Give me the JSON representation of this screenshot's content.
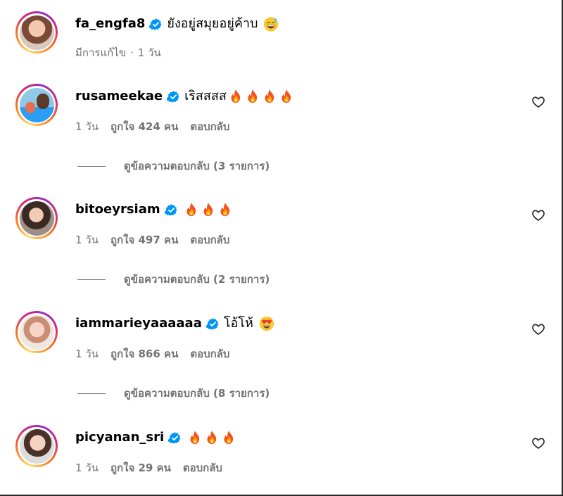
{
  "colors": {
    "verified": "#0095f6",
    "muted_text": "#737373",
    "ring_gradient": [
      "#feda75",
      "#fa7e1e",
      "#d62976",
      "#962fbf"
    ]
  },
  "comments": [
    {
      "username": "fa_engfa8",
      "verified": true,
      "text": "ยังอยู่สมุยอยู่ค้าบ",
      "emoji": "grinning-sweat-emoji",
      "meta": {
        "edited": "มีการแก้ไข",
        "separator": "·",
        "time": "1 วัน"
      }
    },
    {
      "username": "rusameekae",
      "verified": true,
      "text": "เริสสสส",
      "emoji": "fire-emoji",
      "emoji_count": 4,
      "meta": {
        "time": "1 วัน",
        "likes": "ถูกใจ 424 คน",
        "reply": "ตอบกลับ"
      },
      "view_replies": "ดูข้อความตอบกลับ (3 รายการ)"
    },
    {
      "username": "bitoeyrsiam",
      "verified": true,
      "text": "",
      "emoji": "fire-emoji",
      "emoji_count": 3,
      "meta": {
        "time": "1 วัน",
        "likes": "ถูกใจ 497 คน",
        "reply": "ตอบกลับ"
      },
      "view_replies": "ดูข้อความตอบกลับ (2 รายการ)"
    },
    {
      "username": "iammarieyaaaaaa",
      "verified": true,
      "text": "โอ้โห้",
      "emoji": "heart-eyes-emoji",
      "meta": {
        "time": "1 วัน",
        "likes": "ถูกใจ 866 คน",
        "reply": "ตอบกลับ"
      },
      "view_replies": "ดูข้อความตอบกลับ (8 รายการ)"
    },
    {
      "username": "picyanan_sri",
      "verified": true,
      "text": "",
      "emoji": "fire-emoji",
      "emoji_count": 3,
      "meta": {
        "time": "1 วัน",
        "likes": "ถูกใจ 29 คน",
        "reply": "ตอบกลับ"
      }
    }
  ]
}
